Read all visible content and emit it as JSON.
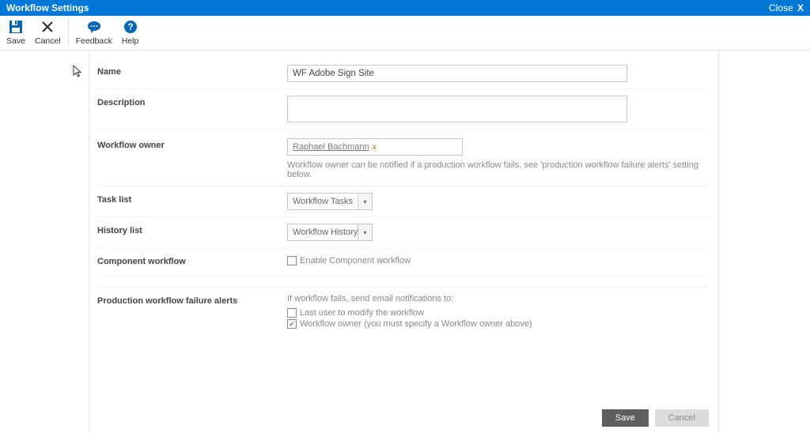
{
  "titlebar": {
    "title": "Workflow Settings",
    "close": "Close"
  },
  "ribbon": {
    "save": "Save",
    "cancel": "Cancel",
    "feedback": "Feedback",
    "help": "Help"
  },
  "form": {
    "name": {
      "label": "Name",
      "value": "WF Adobe Sign Site"
    },
    "description": {
      "label": "Description",
      "value": ""
    },
    "owner": {
      "label": "Workflow owner",
      "person": "Raphael Bachmann",
      "hint": "Workflow owner can be notified if a production workflow fails, see 'production workflow failure alerts' setting below."
    },
    "tasklist": {
      "label": "Task list",
      "value": "Workflow Tasks"
    },
    "historylist": {
      "label": "History list",
      "value": "Workflow History"
    },
    "component": {
      "label": "Component workflow",
      "checkbox": "Enable Component workflow",
      "checked": false
    },
    "alerts": {
      "label": "Production workflow failure alerts",
      "intro": "If workflow fails, send email notifications to:",
      "opt1": {
        "label": "Last user to modify the workflow",
        "checked": false
      },
      "opt2": {
        "label": "Workflow owner (you must specify a Workflow owner above)",
        "checked": true
      }
    }
  },
  "footer": {
    "save": "Save",
    "cancel": "Cancel"
  }
}
